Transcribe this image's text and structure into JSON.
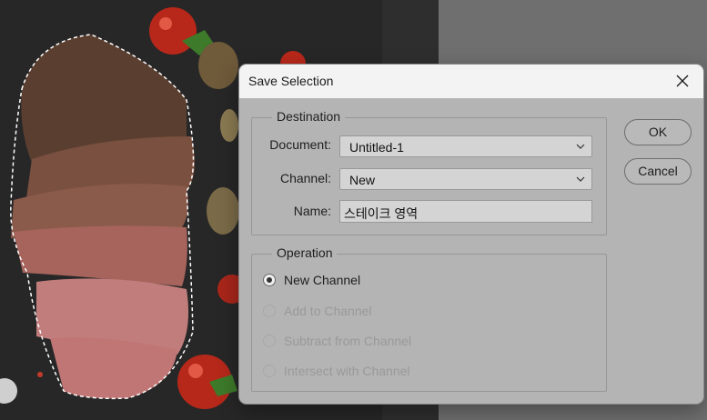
{
  "dialog": {
    "title": "Save Selection",
    "destination": {
      "legend": "Destination",
      "document_label": "Document:",
      "document_value": "Untitled-1",
      "channel_label": "Channel:",
      "channel_value": "New",
      "name_label": "Name:",
      "name_value": "스테이크 영역"
    },
    "operation": {
      "legend": "Operation",
      "options": [
        {
          "label": "New Channel",
          "selected": true,
          "enabled": true
        },
        {
          "label": "Add to Channel",
          "selected": false,
          "enabled": false
        },
        {
          "label": "Subtract from Channel",
          "selected": false,
          "enabled": false
        },
        {
          "label": "Intersect with Channel",
          "selected": false,
          "enabled": false
        }
      ]
    },
    "buttons": {
      "ok": "OK",
      "cancel": "Cancel"
    }
  },
  "icons": {
    "close": "close-icon",
    "dropdown": "chevron-down-icon"
  },
  "colors": {
    "dialog_bg": "#b4b4b4",
    "titlebar_bg": "#f3f3f3",
    "disabled_text": "#999999"
  }
}
